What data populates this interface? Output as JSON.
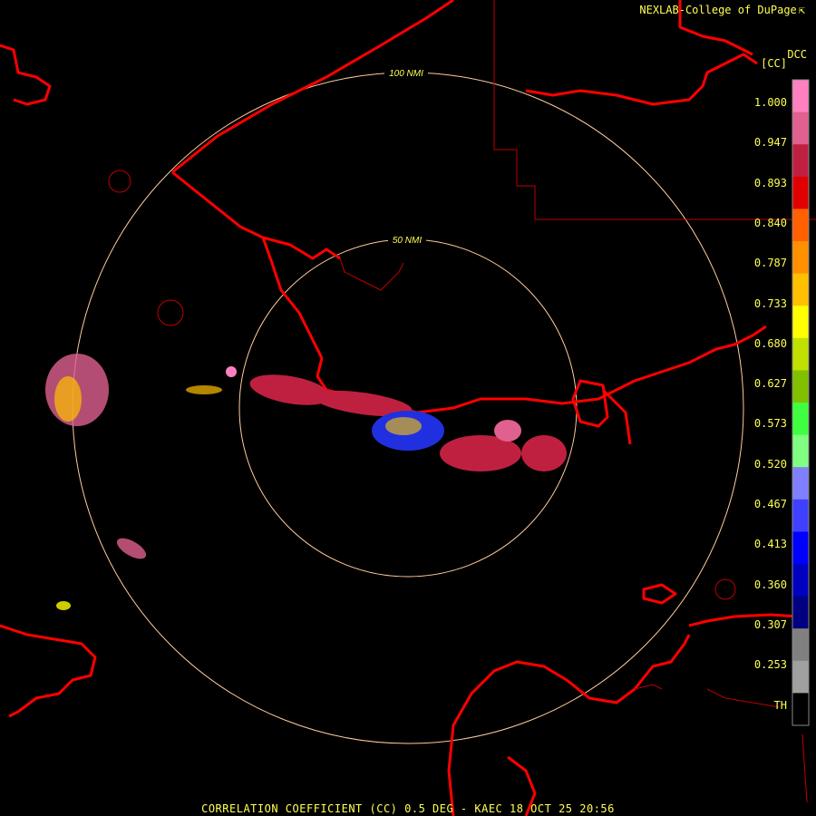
{
  "header": {
    "brand": "NEXLAB-College of DuPage",
    "brand_icon": "arrow-icon"
  },
  "legend": {
    "product_code": "DCC",
    "unit": "[CC]",
    "ticks": [
      "1.000",
      "0.947",
      "0.893",
      "0.840",
      "0.787",
      "0.733",
      "0.680",
      "0.627",
      "0.573",
      "0.520",
      "0.467",
      "0.413",
      "0.360",
      "0.307",
      "0.253",
      "TH"
    ],
    "colors": [
      "#ff80c0",
      "#e06090",
      "#c02040",
      "#e00000",
      "#ff6000",
      "#ff9000",
      "#ffc000",
      "#ffff00",
      "#c0e000",
      "#80c000",
      "#40ff40",
      "#80ff80",
      "#8080ff",
      "#4040ff",
      "#0000ff",
      "#0000c0",
      "#000080",
      "#808080",
      "#a0a0a0",
      "#000000"
    ]
  },
  "map": {
    "ring_labels": [
      "100 NMI",
      "50 NMI"
    ],
    "boundary_color": "#ff0000",
    "ring_color": "#ffcc99"
  },
  "footer": {
    "caption": "CORRELATION COEFFICIENT (CC) 0.5 DEG - KAEC 18 OCT 25 20:56"
  }
}
